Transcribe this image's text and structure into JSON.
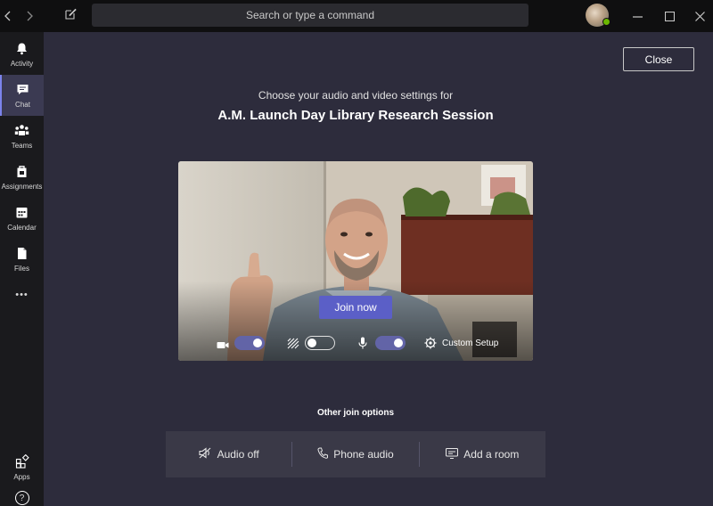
{
  "titlebar": {
    "search_placeholder": "Search or type a command"
  },
  "rail": {
    "items": [
      {
        "label": "Activity",
        "icon": "bell-icon"
      },
      {
        "label": "Chat",
        "icon": "chat-icon",
        "active": true
      },
      {
        "label": "Teams",
        "icon": "teams-icon"
      },
      {
        "label": "Assignments",
        "icon": "assignments-icon"
      },
      {
        "label": "Calendar",
        "icon": "calendar-icon"
      },
      {
        "label": "Files",
        "icon": "files-icon"
      }
    ],
    "more": "•••",
    "apps_label": "Apps",
    "help_label": "?"
  },
  "main": {
    "close_label": "Close",
    "subtitle": "Choose your audio and video settings for",
    "title": "A.M. Launch Day Library Research Session",
    "join_label": "Join now",
    "custom_setup_label": "Custom Setup",
    "other_join_label": "Other join options",
    "options": [
      {
        "label": "Audio off",
        "icon": "speaker-off-icon"
      },
      {
        "label": "Phone audio",
        "icon": "phone-icon"
      },
      {
        "label": "Add a room",
        "icon": "cast-icon"
      }
    ]
  },
  "toggles": {
    "camera": "on",
    "blur": "off",
    "mic": "on"
  },
  "colors": {
    "accent": "#6264a7",
    "join_button": "#5b5fc7",
    "background": "#2d2c3c"
  }
}
